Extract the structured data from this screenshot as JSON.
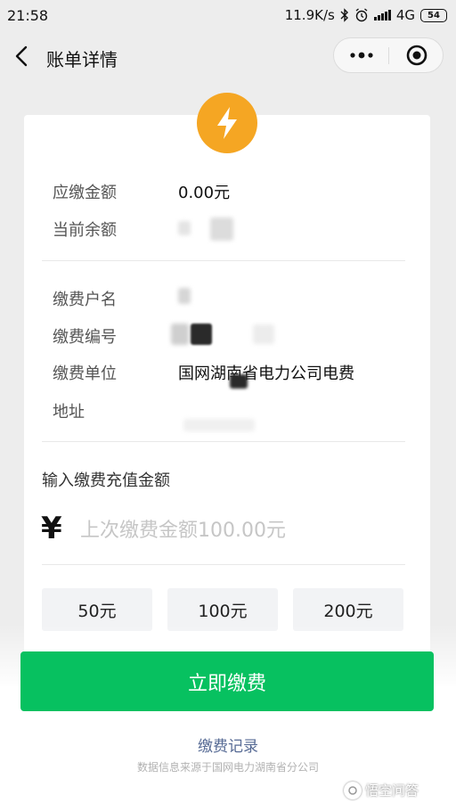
{
  "status_bar": {
    "time": "21:58",
    "network_speed": "11.9K/s",
    "network_type": "4G",
    "battery": "54",
    "icons": [
      "bluetooth-icon",
      "alarm-icon",
      "signal-icon",
      "battery-icon"
    ]
  },
  "nav": {
    "title": "账单详情",
    "back_icon": "back-arrow-icon",
    "more_icon": "more-dots-icon",
    "close_icon": "target-close-icon"
  },
  "bill": {
    "badge_icon": "lightning-icon",
    "badge_color": "#f5a623",
    "amount_due_label": "应缴金额",
    "amount_due_value": "0.00元",
    "balance_label": "当前余额",
    "payer_name_label": "缴费户名",
    "payer_id_label": "缴费编号",
    "payee_label": "缴费单位",
    "payee_value": "国网湖南省电力公司电费",
    "address_label": "地址"
  },
  "recharge": {
    "title": "输入缴费充值金额",
    "currency_symbol": "¥",
    "placeholder": "上次缴费金额100.00元",
    "quick_amounts": [
      "50元",
      "100元",
      "200元"
    ]
  },
  "actions": {
    "pay_now": "立即缴费",
    "pay_color": "#07c160",
    "records_link": "缴费记录",
    "source_note": "数据信息来源于国网电力湖南省分公司"
  },
  "watermark": {
    "text": "悟空问答"
  }
}
